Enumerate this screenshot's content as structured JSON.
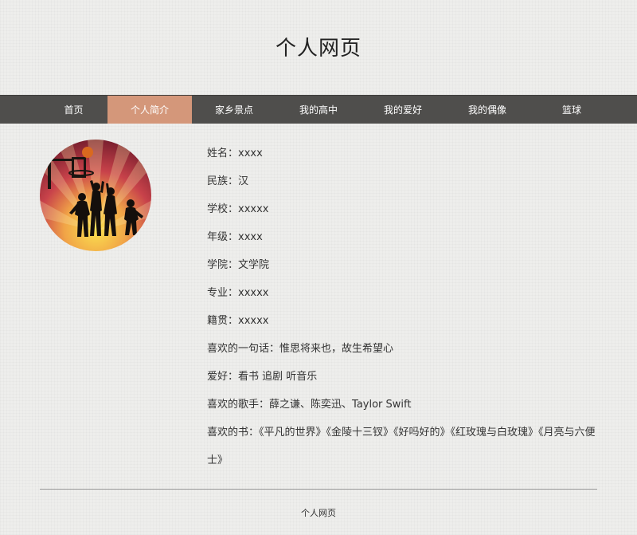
{
  "site_title": "个人网页",
  "nav": {
    "items": [
      {
        "label": "首页",
        "active": false
      },
      {
        "label": "个人简介",
        "active": true
      },
      {
        "label": "家乡景点",
        "active": false
      },
      {
        "label": "我的高中",
        "active": false
      },
      {
        "label": "我的爱好",
        "active": false
      },
      {
        "label": "我的偶像",
        "active": false
      },
      {
        "label": "篮球",
        "active": false
      }
    ]
  },
  "avatar": {
    "subject": "basketball-players-silhouette",
    "colors": [
      "#fbe24f",
      "#e87f3f",
      "#c12a3a",
      "#8a1f2e"
    ]
  },
  "profile": {
    "items": [
      {
        "label": "姓名",
        "value": "xxxx"
      },
      {
        "label": "民族",
        "value": "汉"
      },
      {
        "label": "学校",
        "value": "xxxxx"
      },
      {
        "label": "年级",
        "value": "xxxx"
      },
      {
        "label": "学院",
        "value": "文学院"
      },
      {
        "label": "专业",
        "value": "xxxxx"
      },
      {
        "label": "籍贯",
        "value": "xxxxx"
      },
      {
        "label": "喜欢的一句话",
        "value": "惟思将来也，故生希望心"
      },
      {
        "label": "爱好",
        "value": "看书 追剧 听音乐"
      },
      {
        "label": "喜欢的歌手",
        "value": "薛之谦、陈奕迅、Taylor Swift"
      },
      {
        "label": "喜欢的书",
        "value": "《平凡的世界》《金陵十三钗》《好吗好的》《红玫瑰与白玫瑰》《月亮与六便士》"
      }
    ]
  },
  "footer": {
    "text": "个人网页"
  }
}
